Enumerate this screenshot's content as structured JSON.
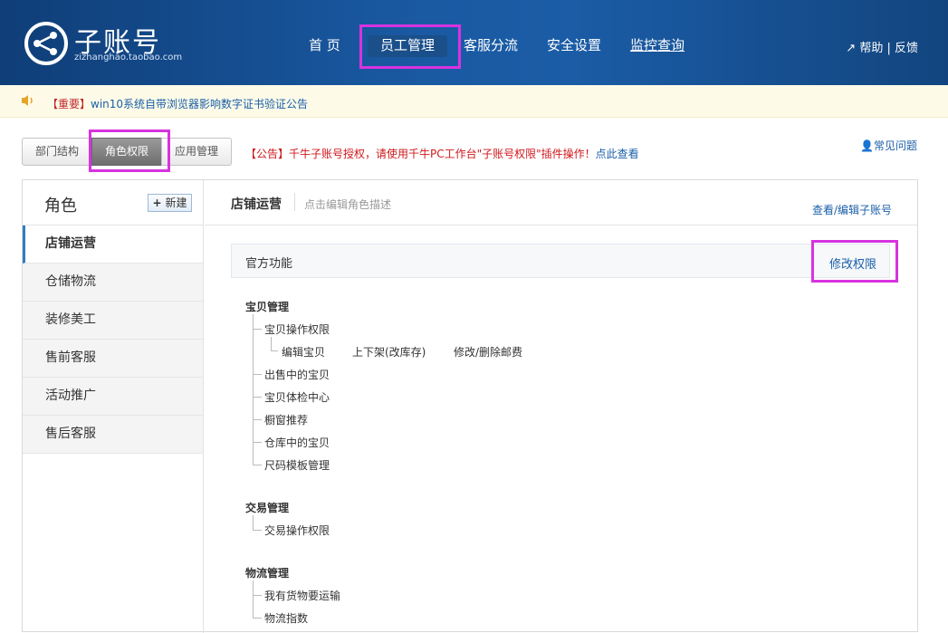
{
  "header": {
    "logo_title": "子账号",
    "logo_sub": "zizhanghao.taobao.com",
    "nav": [
      "首 页",
      "员工管理",
      "客服分流",
      "安全设置",
      "监控查询"
    ],
    "help": "帮助",
    "feedback": "反馈"
  },
  "notice": {
    "tag": "【重要】",
    "text": "win10系统自带浏览器影响数字证书验证公告"
  },
  "tabs": [
    "部门结构",
    "角色权限",
    "应用管理"
  ],
  "announcement": {
    "text": "【公告】千牛子账号授权，请使用千牛PC工作台\"子账号权限\"插件操作！",
    "link": "点此查看"
  },
  "faq": "常见问题",
  "sidebar": {
    "title": "角色",
    "new_button": "新建",
    "roles": [
      "店铺运营",
      "仓储物流",
      "装修美工",
      "售前客服",
      "活动推广",
      "售后客服"
    ]
  },
  "main": {
    "role_name": "店铺运营",
    "role_desc_placeholder": "点击编辑角色描述",
    "view_link": "查看/编辑子账号",
    "section_title": "官方功能",
    "edit_button": "修改权限"
  },
  "tree": {
    "g1": "宝贝管理",
    "g1_items": [
      "宝贝操作权限",
      "出售中的宝贝",
      "宝贝体检中心",
      "橱窗推荐",
      "仓库中的宝贝",
      "尺码模板管理"
    ],
    "g1_sub": [
      "编辑宝贝",
      "上下架(改库存)",
      "修改/删除邮费"
    ],
    "g2": "交易管理",
    "g2_items": [
      "交易操作权限"
    ],
    "g3": "物流管理",
    "g3_items": [
      "我有货物要运输",
      "物流指数"
    ]
  },
  "colors": {
    "header_blue": "#1a5aa3",
    "link_blue": "#1b5fa8",
    "highlight_magenta": "#d733e0",
    "alert_red": "#d0171c"
  }
}
